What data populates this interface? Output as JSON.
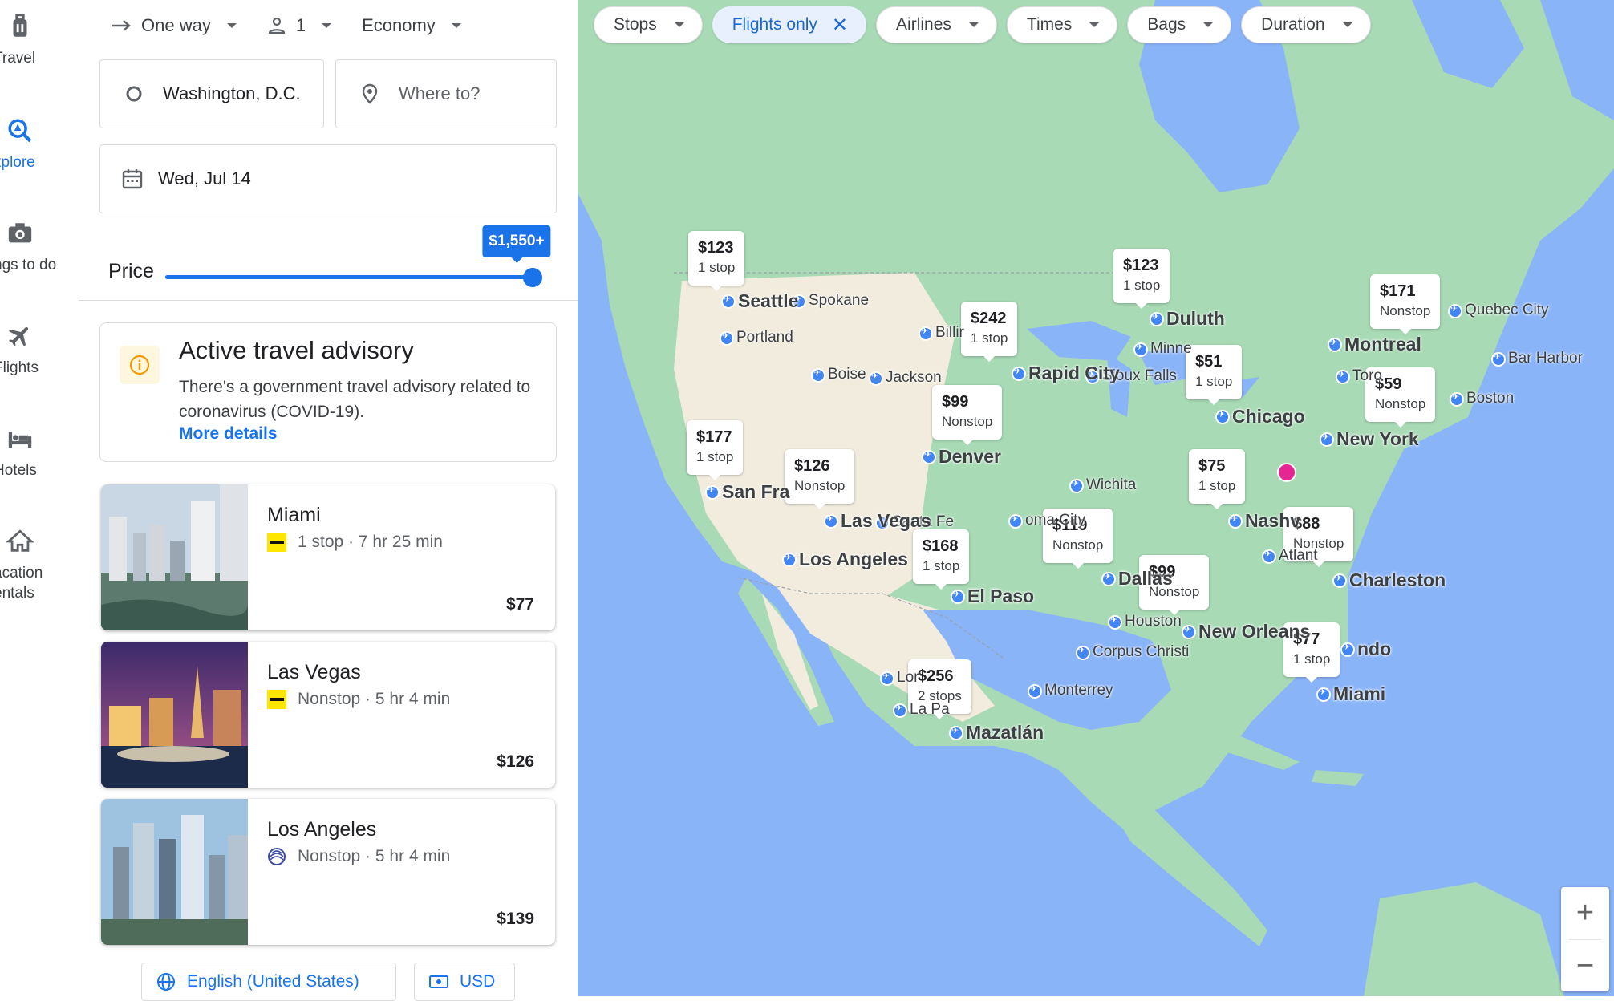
{
  "rail": {
    "items": [
      {
        "label": "Travel",
        "icon": "luggage-icon"
      },
      {
        "label": "xplore",
        "icon": "explore-icon"
      },
      {
        "label": "ngs to do",
        "icon": "camera-icon"
      },
      {
        "label": "Flights",
        "icon": "airplane-icon"
      },
      {
        "label": "Hotels",
        "icon": "bed-icon"
      },
      {
        "label": "acation\nentals",
        "icon": "house-icon"
      }
    ]
  },
  "search": {
    "trip_type": "One way",
    "passengers": "1",
    "cabin": "Economy",
    "origin": "Washington, D.C.",
    "destination_placeholder": "Where to?",
    "date": "Wed, Jul 14"
  },
  "price_filter": {
    "label": "Price",
    "max_label": "$1,550+",
    "fraction": 1.0
  },
  "advisory": {
    "title": "Active travel advisory",
    "body": "There's a government travel advisory related to coronavirus (COVID-19).",
    "link": "More details"
  },
  "results": [
    {
      "city": "Miami",
      "stops": "1 stop",
      "duration": "7 hr 25 min",
      "price": "$77",
      "airline": "spirit"
    },
    {
      "city": "Las Vegas",
      "stops": "Nonstop",
      "duration": "5 hr 4 min",
      "price": "$126",
      "airline": "spirit"
    },
    {
      "city": "Los Angeles",
      "stops": "Nonstop",
      "duration": "5 hr 4 min",
      "price": "$139",
      "airline": "united"
    }
  ],
  "footer": {
    "language": "English (United States)",
    "currency": "USD"
  },
  "map": {
    "filters": [
      {
        "label": "Stops",
        "active": false
      },
      {
        "label": "Flights only",
        "active": true
      },
      {
        "label": "Airlines",
        "active": false
      },
      {
        "label": "Times",
        "active": false
      },
      {
        "label": "Bags",
        "active": false
      },
      {
        "label": "Duration",
        "active": false
      }
    ],
    "price_tags": [
      {
        "price": "$123",
        "stops": "1 stop"
      },
      {
        "price": "$123",
        "stops": "1 stop"
      },
      {
        "price": "$171",
        "stops": "Nonstop"
      },
      {
        "price": "$242",
        "stops": "1 stop"
      },
      {
        "price": "$51",
        "stops": "1 stop"
      },
      {
        "price": "$59",
        "stops": "Nonstop"
      },
      {
        "price": "$99",
        "stops": "Nonstop"
      },
      {
        "price": "$177",
        "stops": "1 stop"
      },
      {
        "price": "$126",
        "stops": "Nonstop"
      },
      {
        "price": "$75",
        "stops": "1 stop"
      },
      {
        "price": "$119",
        "stops": "Nonstop"
      },
      {
        "price": "$88",
        "stops": "Nonstop"
      },
      {
        "price": "$168",
        "stops": "1 stop"
      },
      {
        "price": "$99",
        "stops": "Nonstop"
      },
      {
        "price": "$77",
        "stops": "1 stop"
      },
      {
        "price": "$256",
        "stops": "2 stops"
      }
    ],
    "cities_major": [
      "Seattle",
      "Duluth",
      "Montreal",
      "Rapid City",
      "Chicago",
      "New York",
      "Denver",
      "San Fra",
      "Las Vegas",
      "Los Angeles",
      "El Paso",
      "Dallas",
      "New Orleans",
      "Charleston",
      "Miami",
      "Mazatlán",
      "Nashv",
      "ndo"
    ],
    "cities_minor": [
      "Spokane",
      "Portland",
      "Boise",
      "Billir",
      "Jackson",
      "Minne",
      "Sioux Falls",
      "Toro",
      "Quebec City",
      "Bar Harbor",
      "Boston",
      "Wichita",
      "oma City",
      "Santa Fe",
      "Atlant",
      "Houston",
      "Corpus Christi",
      "Monterrey",
      "Lor",
      "La Pa"
    ],
    "colors": {
      "water": "#8ab4f8",
      "land_green": "#a8dab5",
      "land_dry": "#f1ecde",
      "pin": "#4285f4",
      "home": "#e52592"
    }
  },
  "colors": {
    "accent": "#1a73e8",
    "chip_active_bg": "#e8f0fe",
    "spirit": "#ffe600",
    "united": "#3c4a9e"
  }
}
